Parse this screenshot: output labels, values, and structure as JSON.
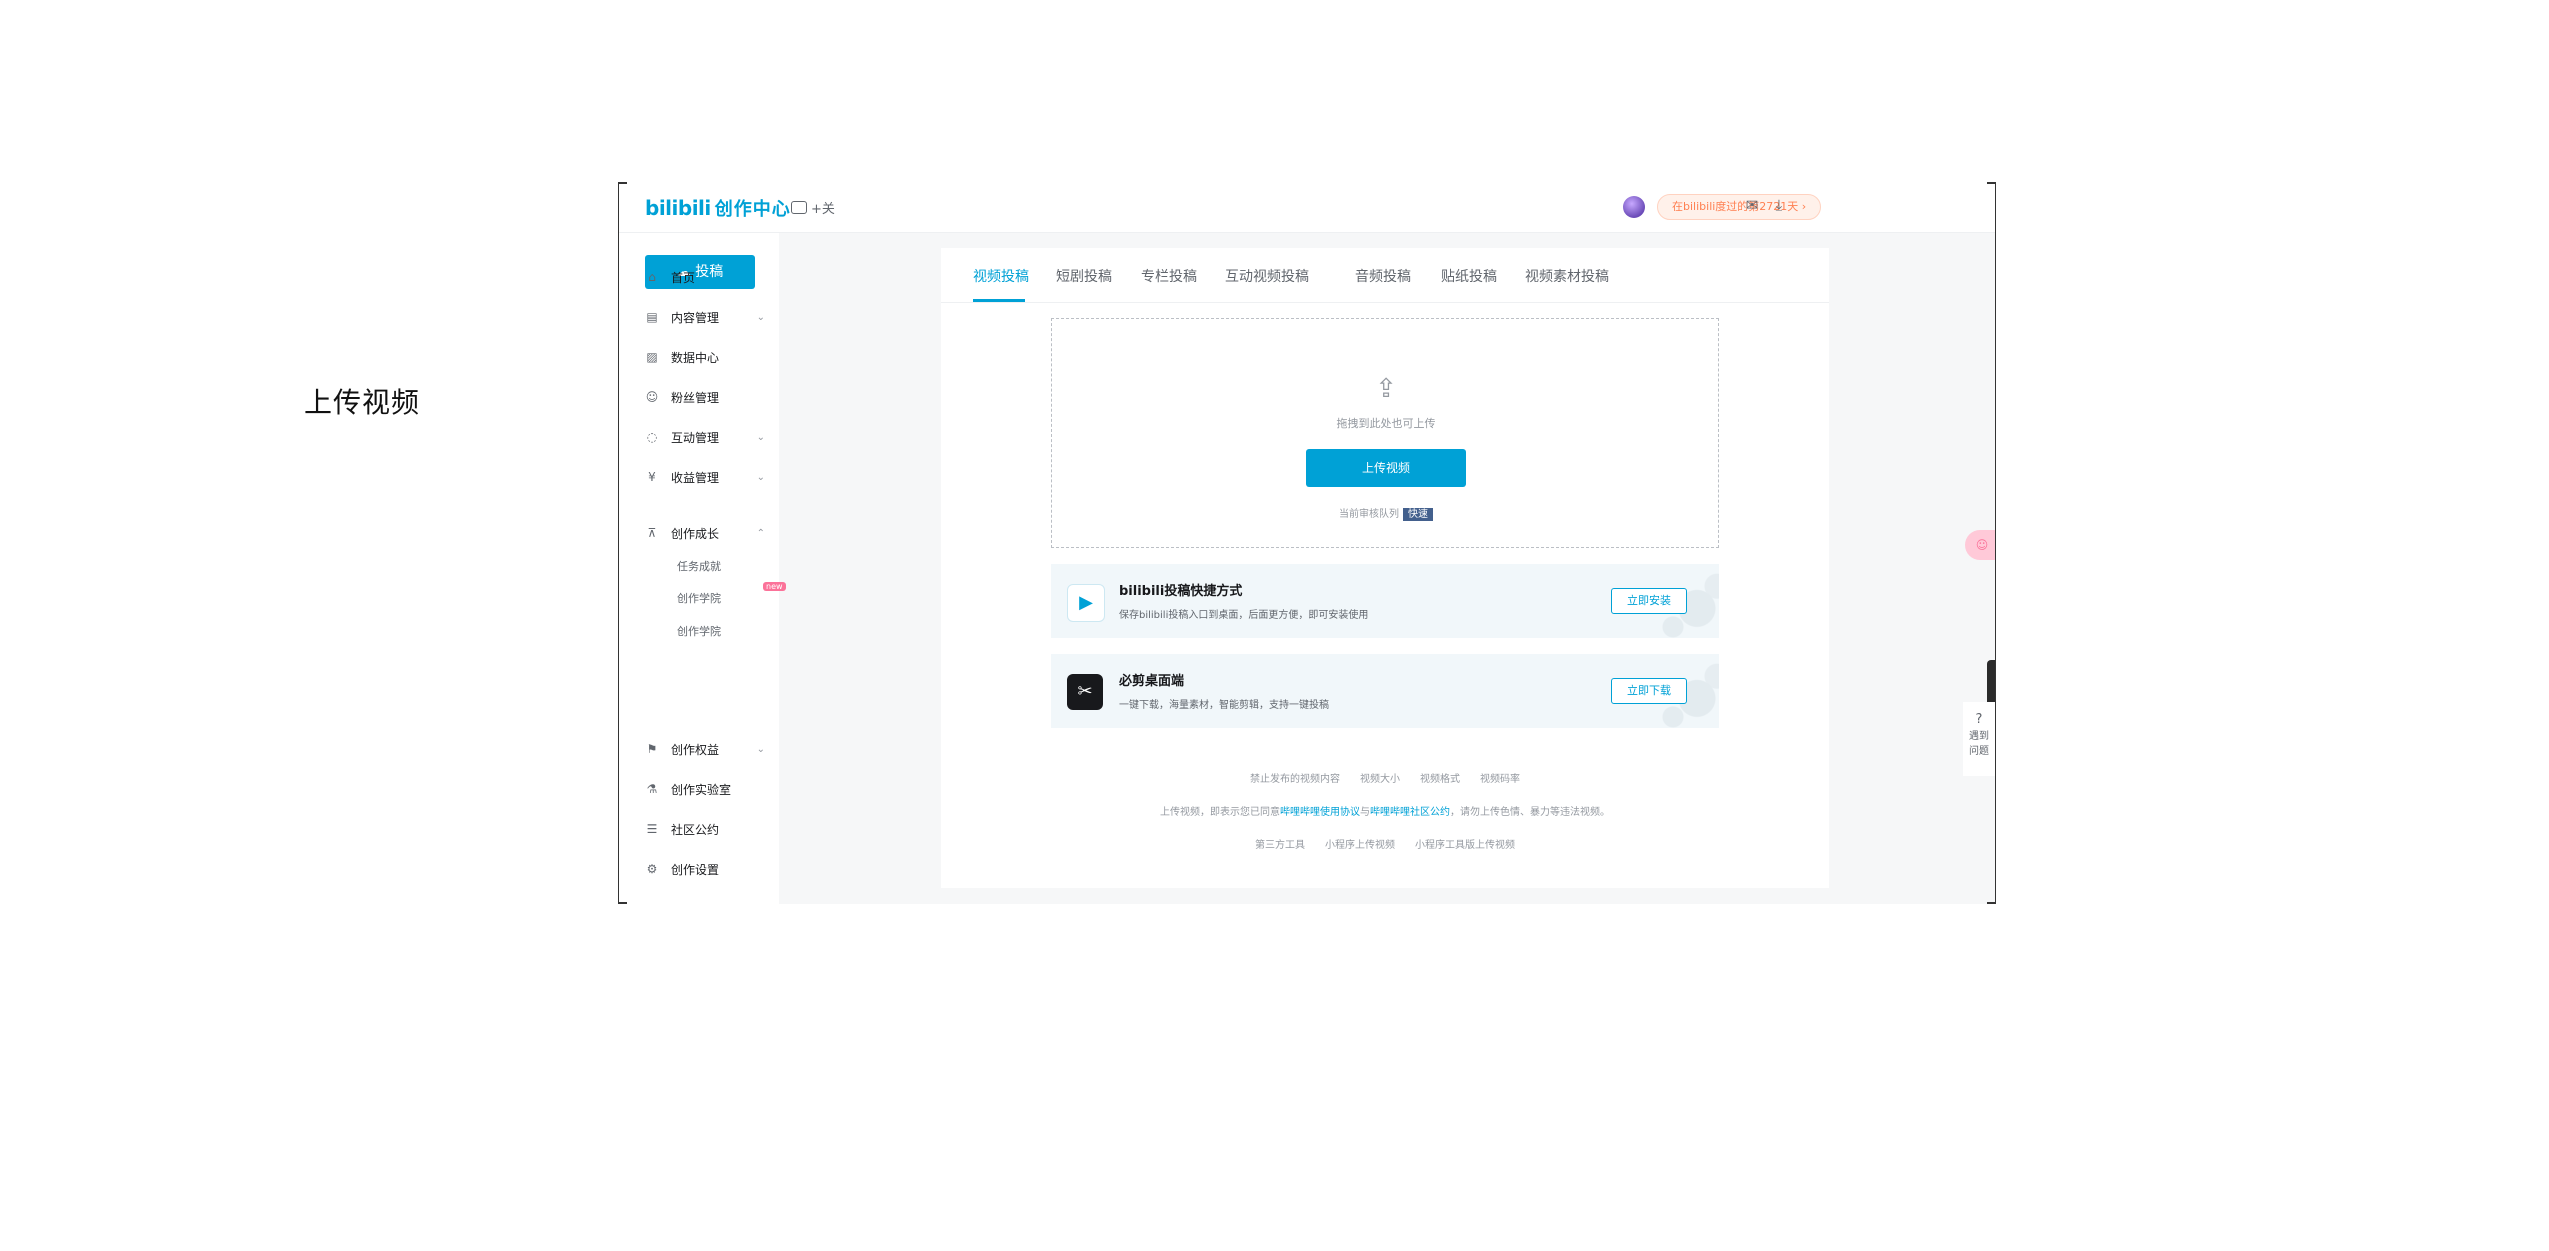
{
  "caption": "上传视频",
  "header": {
    "logo": "bilibili",
    "logo_suffix": "创作中心",
    "vip_label": "+关",
    "notice": "在bilibili度过的第2721天",
    "notice_arrow": "›"
  },
  "sidebar": {
    "upload_button": "投稿",
    "items": [
      {
        "label": "首页",
        "icon": "home-icon",
        "glyph": "⌂"
      },
      {
        "label": "内容管理",
        "icon": "document-icon",
        "glyph": "▤",
        "expand": "⌄"
      },
      {
        "label": "数据中心",
        "icon": "chart-icon",
        "glyph": "▨"
      },
      {
        "label": "粉丝管理",
        "icon": "user-icon",
        "glyph": "☺"
      },
      {
        "label": "互动管理",
        "icon": "chat-icon",
        "glyph": "◌",
        "expand": "⌄"
      },
      {
        "label": "收益管理",
        "icon": "money-icon",
        "glyph": "¥",
        "expand": "⌄"
      },
      {
        "label": "创作成长",
        "icon": "graduation-icon",
        "glyph": "⊼",
        "expand": "⌃"
      },
      {
        "label": "创作权益",
        "icon": "flag-icon",
        "glyph": "⚑",
        "expand": "⌄"
      },
      {
        "label": "创作实验室",
        "icon": "flask-icon",
        "glyph": "⚗"
      },
      {
        "label": "社区公约",
        "icon": "rules-icon",
        "glyph": "☰"
      },
      {
        "label": "创作设置",
        "icon": "settings-icon",
        "glyph": "⚙"
      }
    ],
    "subitems": [
      "任务成就",
      "创作学院",
      "创作学院"
    ],
    "subitem_new": "new"
  },
  "tabs": [
    "视频投稿",
    "短剧投稿",
    "专栏投稿",
    "互动视频投稿",
    "音频投稿",
    "贴纸投稿",
    "视频素材投稿"
  ],
  "upload": {
    "hint": "拖拽到此处也可上传",
    "button": "上传视频",
    "footer": "当前审核队列",
    "footer_tag": "快速"
  },
  "promos": [
    {
      "title": "bilibili投稿快捷方式",
      "desc": "保存bilibili投稿入口到桌面，后面更方便，即可安装使用",
      "button": "立即安装",
      "glyph": "▶"
    },
    {
      "title": "必剪桌面端",
      "desc": "一键下载，海量素材，智能剪辑，支持一键投稿",
      "button": "立即下载",
      "glyph": "✂"
    }
  ],
  "footer": {
    "line1": [
      "禁止发布的视频内容",
      "视频大小",
      "视频格式",
      "视频码率"
    ],
    "line2_prefix": "上传视频，即表示您已同意",
    "line2_link1": "哔哩哔哩使用协议",
    "line2_mid": "与",
    "line2_link2": "哔哩哔哩社区公约",
    "line2_suffix": "，请勿上传色情、暴力等违法视频。",
    "line3": [
      "第三方工具",
      "小程序上传视频",
      "小程序工具版上传视频"
    ]
  },
  "right_float": {
    "pink": "☺",
    "help": "遇到问题"
  },
  "colors": {
    "accent": "#00a1d6",
    "pink": "#fb7299",
    "notice_bg": "#fff1ea"
  }
}
